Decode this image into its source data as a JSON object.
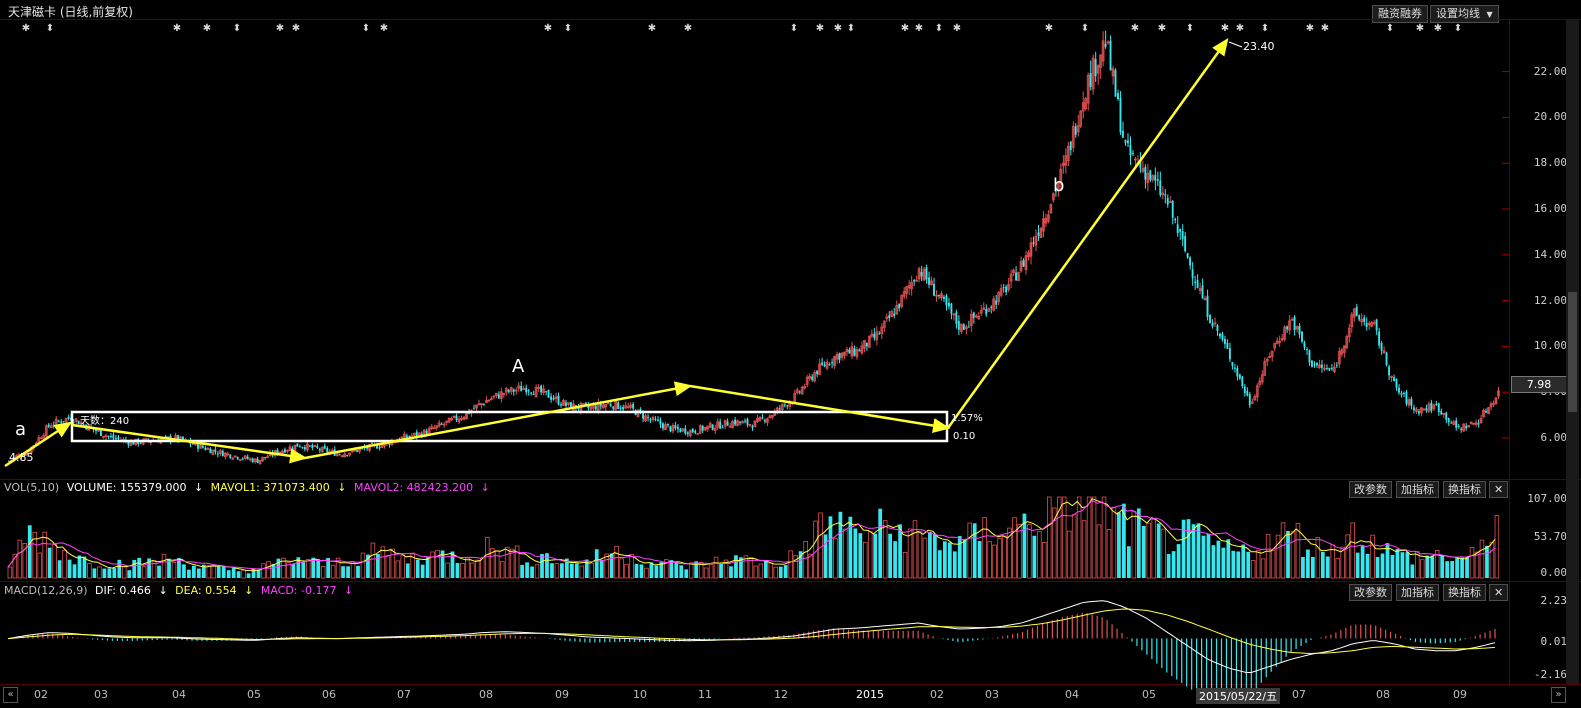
{
  "title": "天津磁卡 (日线,前复权)",
  "top_buttons": [
    "融资融券",
    "设置均线"
  ],
  "current_price": "7.98",
  "price_axis": [
    "22.00",
    "20.00",
    "18.00",
    "16.00",
    "14.00",
    "12.00",
    "10.00",
    "8.00",
    "6.00"
  ],
  "annotations": {
    "high": "23.40",
    "low": "4.85",
    "box_days": "天数：240",
    "box_pct": "1.57%",
    "box_low": "0.10",
    "label_a": "a",
    "label_A": "A",
    "label_b": "b"
  },
  "vol_panel": {
    "name": "VOL(5,10)",
    "volume": "VOLUME: 155379.000",
    "mavol1": "MAVOL1: 371073.400",
    "mavol2": "MAVOL2: 482423.200",
    "axis": [
      "107.00",
      "53.70",
      "0.00"
    ],
    "buttons": [
      "改参数",
      "加指标",
      "换指标",
      "✕"
    ]
  },
  "macd_panel": {
    "name": "MACD(12,26,9)",
    "dif": "DIF: 0.466",
    "dea": "DEA: 0.554",
    "macd": "MACD: -0.177",
    "axis": [
      "2.23",
      "0.01",
      "-2.16"
    ],
    "buttons": [
      "改参数",
      "加指标",
      "换指标",
      "✕"
    ]
  },
  "x_axis": [
    "02",
    "03",
    "04",
    "05",
    "06",
    "07",
    "08",
    "09",
    "10",
    "11",
    "12",
    "2015",
    "02",
    "03",
    "04",
    "05",
    "2015/05/22/五",
    "07",
    "08",
    "09"
  ],
  "colors": {
    "up": "#e05050",
    "down": "#35e8f0",
    "trend": "#ffff30",
    "box": "#ffffff",
    "ma1": "#ffff40",
    "ma2": "#ff40ff"
  },
  "chart_data": {
    "type": "candlestick",
    "series": [
      {
        "name": "price",
        "values": [
          5.0,
          5.5,
          6.6,
          6.9,
          6.4,
          6.0,
          5.8,
          5.9,
          6.0,
          5.7,
          5.4,
          5.2,
          5.0,
          5.4,
          5.7,
          5.5,
          5.3,
          5.5,
          5.7,
          6.0,
          6.2,
          6.6,
          7.0,
          7.6,
          8.0,
          8.2,
          7.9,
          7.4,
          7.3,
          7.5,
          7.3,
          6.8,
          6.4,
          6.3,
          6.5,
          6.7,
          6.6,
          7.1,
          7.8,
          8.9,
          9.6,
          9.8,
          10.5,
          11.8,
          13.4,
          12.1,
          10.8,
          11.5,
          12.3,
          13.6,
          15.6,
          17.8,
          21.2,
          23.4,
          18.5,
          17.6,
          16.3,
          13.8,
          11.4,
          9.6,
          7.5,
          9.8,
          11.2,
          9.2,
          8.9,
          11.4,
          10.8,
          8.2,
          7.2,
          7.4,
          6.4,
          6.7,
          7.98
        ]
      },
      {
        "name": "VOLUME",
        "values": [
          20,
          60,
          45,
          28,
          22,
          20,
          18,
          22,
          25,
          16,
          12,
          10,
          12,
          20,
          25,
          18,
          22,
          28,
          35,
          25,
          30,
          30,
          28,
          40,
          35,
          25,
          28,
          20,
          22,
          35,
          30,
          20,
          18,
          16,
          20,
          25,
          22,
          18,
          30,
          60,
          75,
          55,
          65,
          60,
          55,
          50,
          45,
          60,
          65,
          70,
          75,
          90,
          105,
          80,
          70,
          60,
          50,
          55,
          45,
          35,
          35,
          50,
          60,
          40,
          40,
          58,
          45,
          30,
          28,
          30,
          25,
          30,
          95
        ]
      },
      {
        "name": "DIF",
        "values": [
          0.0,
          0.2,
          0.35,
          0.3,
          0.2,
          0.1,
          0.05,
          0.05,
          0.05,
          -0.02,
          -0.05,
          -0.08,
          -0.1,
          0.0,
          0.05,
          0.02,
          0.0,
          0.05,
          0.08,
          0.12,
          0.15,
          0.2,
          0.25,
          0.35,
          0.4,
          0.35,
          0.3,
          0.2,
          0.1,
          0.05,
          0.0,
          -0.05,
          -0.1,
          -0.12,
          -0.1,
          -0.05,
          -0.02,
          0.05,
          0.15,
          0.35,
          0.55,
          0.6,
          0.7,
          0.8,
          0.9,
          0.7,
          0.55,
          0.6,
          0.7,
          0.9,
          1.3,
          1.7,
          2.1,
          2.2,
          1.8,
          1.2,
          0.4,
          -0.4,
          -1.2,
          -1.7,
          -2.0,
          -1.6,
          -1.2,
          -0.9,
          -0.7,
          -0.3,
          -0.1,
          -0.3,
          -0.6,
          -0.7,
          -0.7,
          -0.5,
          -0.2
        ]
      },
      {
        "name": "DEA",
        "values": [
          0.0,
          0.1,
          0.2,
          0.25,
          0.22,
          0.17,
          0.12,
          0.1,
          0.08,
          0.05,
          0.02,
          -0.02,
          -0.05,
          -0.04,
          -0.01,
          0.0,
          0.0,
          0.02,
          0.04,
          0.07,
          0.1,
          0.13,
          0.17,
          0.22,
          0.28,
          0.3,
          0.3,
          0.27,
          0.22,
          0.16,
          0.1,
          0.05,
          0.0,
          -0.05,
          -0.07,
          -0.07,
          -0.05,
          -0.02,
          0.03,
          0.12,
          0.25,
          0.37,
          0.48,
          0.58,
          0.68,
          0.7,
          0.66,
          0.64,
          0.65,
          0.72,
          0.87,
          1.08,
          1.35,
          1.6,
          1.72,
          1.64,
          1.38,
          1.0,
          0.56,
          0.1,
          -0.32,
          -0.6,
          -0.8,
          -0.86,
          -0.82,
          -0.7,
          -0.5,
          -0.45,
          -0.5,
          -0.55,
          -0.6,
          -0.58,
          -0.5
        ]
      }
    ],
    "y_range_price": [
      4.5,
      24.0
    ],
    "y_range_vol": [
      0,
      107
    ],
    "y_range_macd": [
      -2.16,
      2.23
    ]
  }
}
